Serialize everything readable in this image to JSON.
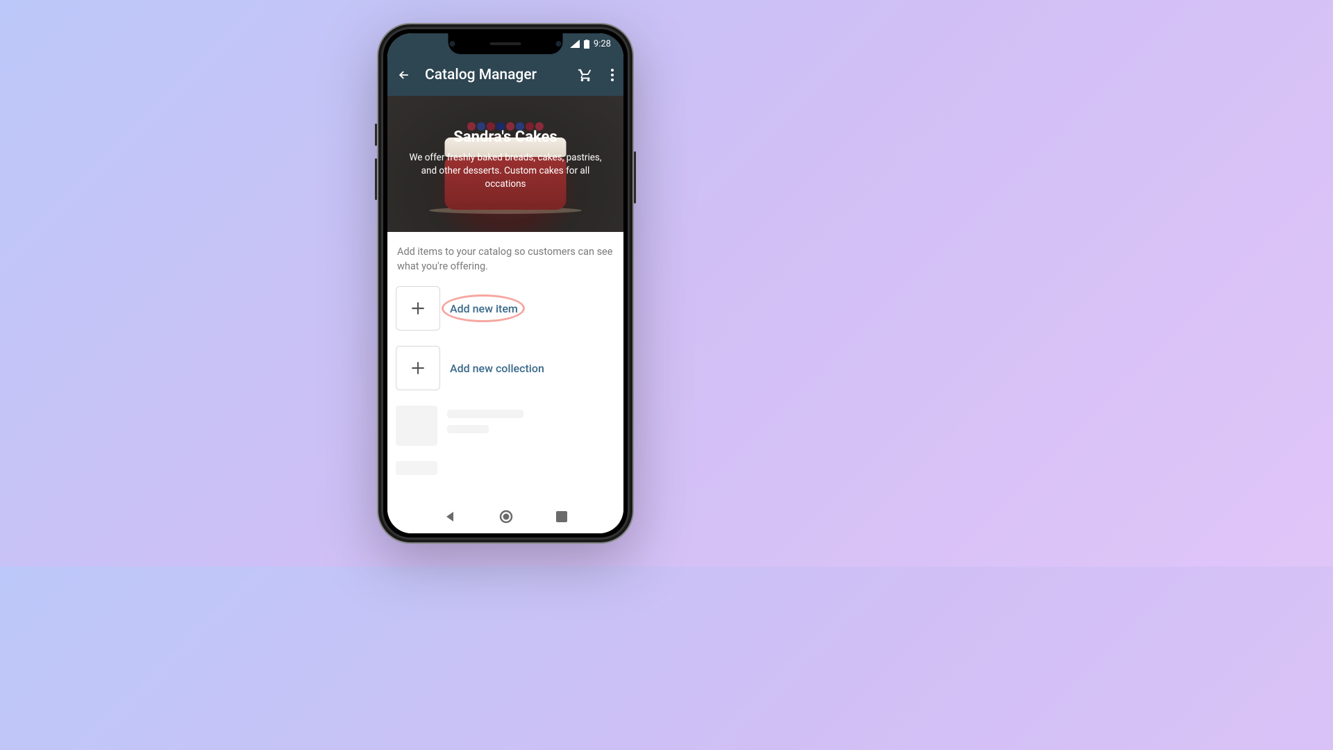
{
  "status": {
    "time": "9:28"
  },
  "appbar": {
    "title": "Catalog Manager"
  },
  "hero": {
    "business_name": "Sandra's Cakes",
    "description": "We offer freshly baked breads, cakes, pastries, and other desserts. Custom cakes for all occations"
  },
  "hint": "Add items to your catalog so customers can see what you're offering.",
  "actions": {
    "add_item": "Add new item",
    "add_collection": "Add new collection"
  }
}
